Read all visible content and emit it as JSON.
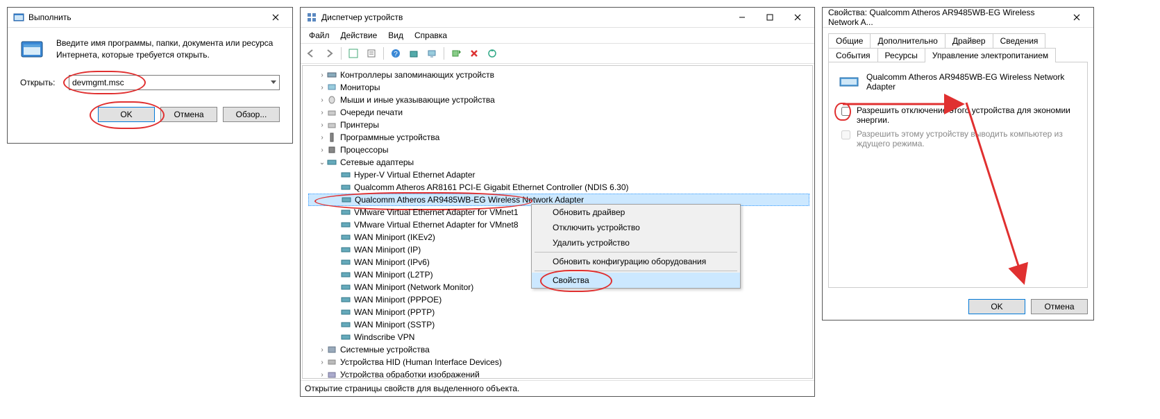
{
  "run": {
    "title": "Выполнить",
    "instruction": "Введите имя программы, папки, документа или ресурса Интернета, которые требуется открыть.",
    "open_label": "Открыть:",
    "input_value": "devmgmt.msc",
    "ok": "OK",
    "cancel": "Отмена",
    "browse": "Обзор..."
  },
  "devmgr": {
    "title": "Диспетчер устройств",
    "menu": {
      "file": "Файл",
      "action": "Действие",
      "view": "Вид",
      "help": "Справка"
    },
    "categories": {
      "storage_controllers": "Контроллеры запоминающих устройств",
      "monitors": "Мониторы",
      "mice": "Мыши и иные указывающие устройства",
      "print_queues": "Очереди печати",
      "printers": "Принтеры",
      "software_devices": "Программные устройства",
      "processors": "Процессоры",
      "network_adapters": "Сетевые адаптеры",
      "system_devices": "Системные устройства",
      "hid": "Устройства HID (Human Interface Devices)",
      "imaging": "Устройства обработки изображений"
    },
    "adapters": [
      "Hyper-V Virtual Ethernet Adapter",
      "Qualcomm Atheros AR8161 PCI-E Gigabit Ethernet Controller (NDIS 6.30)",
      "Qualcomm Atheros AR9485WB-EG Wireless Network Adapter",
      "VMware Virtual Ethernet Adapter for VMnet1",
      "VMware Virtual Ethernet Adapter for VMnet8",
      "WAN Miniport (IKEv2)",
      "WAN Miniport (IP)",
      "WAN Miniport (IPv6)",
      "WAN Miniport (L2TP)",
      "WAN Miniport (Network Monitor)",
      "WAN Miniport (PPPOE)",
      "WAN Miniport (PPTP)",
      "WAN Miniport (SSTP)",
      "Windscribe VPN"
    ],
    "context": {
      "update_driver": "Обновить драйвер",
      "disable_device": "Отключить устройство",
      "remove_device": "Удалить устройство",
      "scan_hw": "Обновить конфигурацию оборудования",
      "properties": "Свойства"
    },
    "status": "Открытие страницы свойств для выделенного объекта."
  },
  "prop": {
    "title": "Свойства: Qualcomm Atheros AR9485WB-EG Wireless Network A...",
    "tabs": {
      "general": "Общие",
      "advanced": "Дополнительно",
      "driver": "Драйвер",
      "details": "Сведения",
      "events": "События",
      "resources": "Ресурсы",
      "power": "Управление электропитанием"
    },
    "adapter_name": "Qualcomm Atheros AR9485WB-EG Wireless Network Adapter",
    "cb1": "Разрешить отключение этого устройства для экономии энергии.",
    "cb2": "Разрешить этому устройству выводить компьютер из ждущего режима.",
    "ok": "OK",
    "cancel": "Отмена"
  }
}
